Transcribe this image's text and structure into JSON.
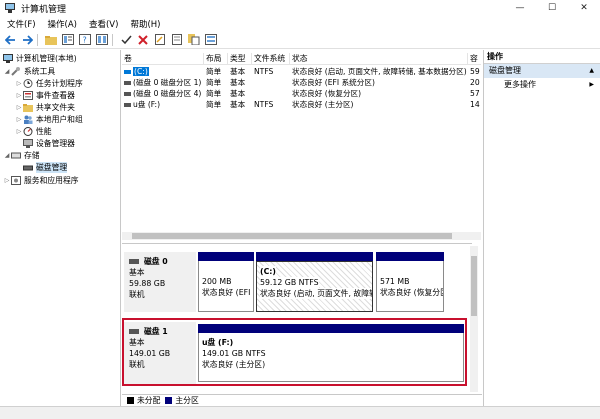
{
  "window": {
    "title": "计算机管理",
    "minimize": "—",
    "maximize": "☐",
    "close": "✕"
  },
  "menu": [
    "文件(F)",
    "操作(A)",
    "查看(V)",
    "帮助(H)"
  ],
  "toolbar_icons": [
    "back-icon",
    "forward-icon",
    "folder-up-icon",
    "properties-icon",
    "help-icon",
    "export-icon",
    "check-icon",
    "delete-icon",
    "edit-icon",
    "open-icon",
    "save-icon",
    "settings-icon"
  ],
  "tree": {
    "root": "计算机管理(本地)",
    "system_tools": "系统工具",
    "task_scheduler": "任务计划程序",
    "event_viewer": "事件查看器",
    "shared_folders": "共享文件夹",
    "local_users": "本地用户和组",
    "performance": "性能",
    "device_manager": "设备管理器",
    "storage": "存储",
    "disk_management": "磁盘管理",
    "services": "服务和应用程序"
  },
  "columns": [
    "卷",
    "布局",
    "类型",
    "文件系统",
    "状态",
    "容"
  ],
  "volumes": [
    {
      "name": "(C:)",
      "layout": "简单",
      "type": "基本",
      "fs": "NTFS",
      "status": "状态良好 (启动, 页面文件, 故障转储, 基本数据分区)",
      "cap": "59"
    },
    {
      "name": "(磁盘 0 磁盘分区 1)",
      "layout": "简单",
      "type": "基本",
      "fs": "",
      "status": "状态良好 (EFI 系统分区)",
      "cap": "20"
    },
    {
      "name": "(磁盘 0 磁盘分区 4)",
      "layout": "简单",
      "type": "基本",
      "fs": "",
      "status": "状态良好 (恢复分区)",
      "cap": "57"
    },
    {
      "name": "u盘 (F:)",
      "layout": "简单",
      "type": "基本",
      "fs": "NTFS",
      "status": "状态良好 (主分区)",
      "cap": "14"
    }
  ],
  "disk0": {
    "name": "磁盘 0",
    "type": "基本",
    "size": "59.88 GB",
    "state": "联机",
    "partitions": [
      {
        "label": "",
        "size": "200 MB",
        "status": "状态良好 (EFI"
      },
      {
        "label": "(C:)",
        "size": "59.12 GB NTFS",
        "status": "状态良好 (启动, 页面文件, 故障转"
      },
      {
        "label": "",
        "size": "571 MB",
        "status": "状态良好 (恢复分区"
      }
    ]
  },
  "disk1": {
    "name": "磁盘 1",
    "type": "基本",
    "size": "149.01 GB",
    "state": "联机",
    "partition": {
      "label": "u盘  (F:)",
      "size": "149.01 GB NTFS",
      "status": "状态良好 (主分区)"
    }
  },
  "legend": {
    "unallocated": "未分配",
    "primary": "主分区",
    "unallocated_color": "#000000",
    "primary_color": "#00007a"
  },
  "actions": {
    "header": "操作",
    "section": "磁盘管理",
    "more": "更多操作",
    "arrow_up": "▲",
    "arrow_right": "▶"
  },
  "colors": {
    "accent": "#0078d7",
    "partition_bar": "#00007a",
    "highlight": "#c8102e",
    "selection": "#cce4f7"
  }
}
